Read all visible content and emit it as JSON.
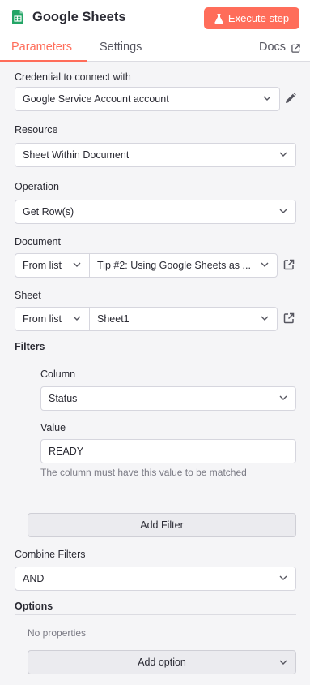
{
  "header": {
    "title": "Google Sheets",
    "execute_label": "Execute step",
    "accent_color": "#ff6d5a",
    "node_icon": "google-sheets-icon"
  },
  "tabs": {
    "parameters": "Parameters",
    "settings": "Settings",
    "docs": "Docs"
  },
  "credential": {
    "label": "Credential to connect with",
    "value": "Google Service Account account"
  },
  "resource": {
    "label": "Resource",
    "value": "Sheet Within Document"
  },
  "operation": {
    "label": "Operation",
    "value": "Get Row(s)"
  },
  "document": {
    "label": "Document",
    "mode": "From list",
    "value": "Tip #2: Using Google Sheets as ..."
  },
  "sheet": {
    "label": "Sheet",
    "mode": "From list",
    "value": "Sheet1"
  },
  "filters": {
    "title": "Filters",
    "column_label": "Column",
    "column_value": "Status",
    "value_label": "Value",
    "value_value": "READY",
    "hint": "The column must have this value to be matched",
    "add_filter": "Add Filter"
  },
  "combine": {
    "label": "Combine Filters",
    "value": "AND"
  },
  "options": {
    "title": "Options",
    "empty": "No properties",
    "add_option": "Add option"
  }
}
